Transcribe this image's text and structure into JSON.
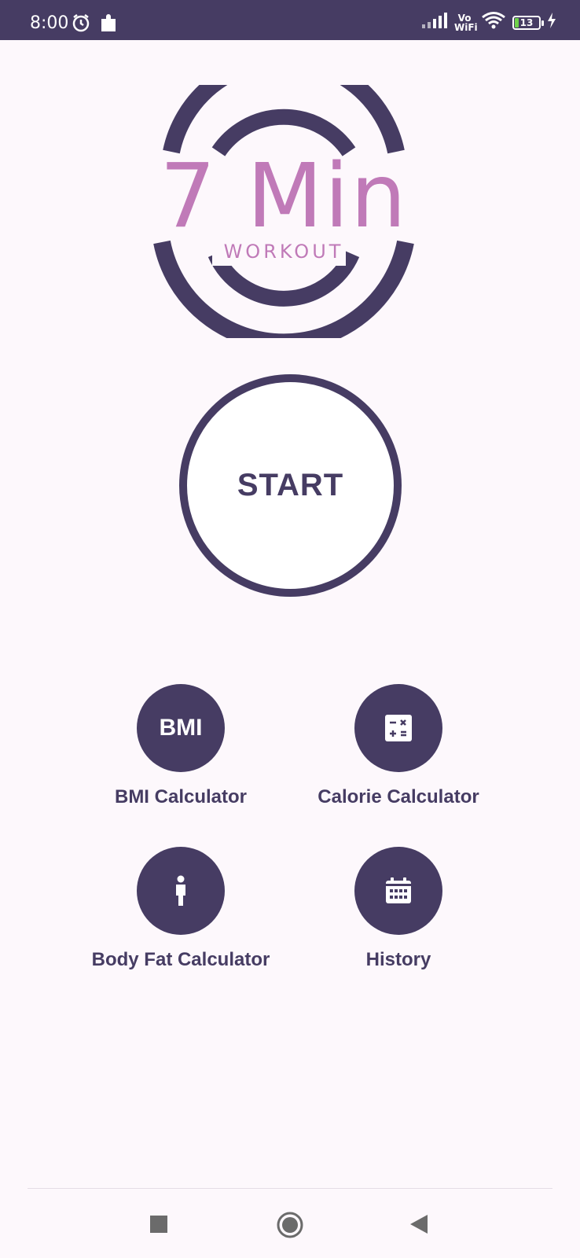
{
  "status_bar": {
    "time": "8:00",
    "network": "Vo WiFi",
    "battery": "13"
  },
  "logo": {
    "main_text": "7 Min",
    "sub_text": "WORKOUT"
  },
  "start_button": {
    "label": "START"
  },
  "features": [
    {
      "id": "bmi",
      "label": "BMI Calculator",
      "icon_text": "BMI",
      "icon": "bmi-text-icon"
    },
    {
      "id": "calorie",
      "label": "Calorie Calculator",
      "icon": "calculator-icon"
    },
    {
      "id": "body-fat",
      "label": "Body Fat Calculator",
      "icon": "person-icon"
    },
    {
      "id": "history",
      "label": "History",
      "icon": "calendar-icon"
    }
  ],
  "colors": {
    "primary": "#463c63",
    "accent": "#c07ab8",
    "background": "#fdf8fc"
  },
  "nav_bar": {
    "buttons": [
      "recent-apps",
      "home",
      "back"
    ]
  }
}
